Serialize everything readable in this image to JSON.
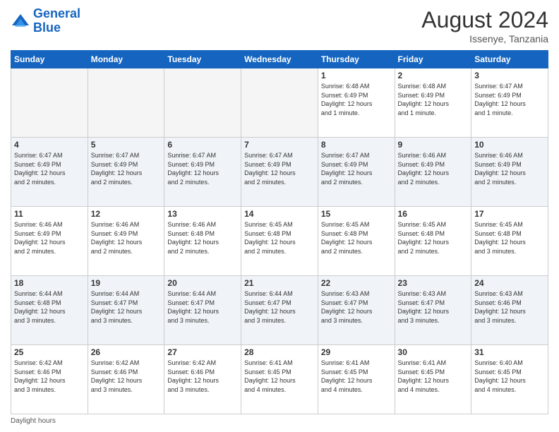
{
  "header": {
    "logo_line1": "General",
    "logo_line2": "Blue",
    "month_title": "August 2024",
    "location": "Issenye, Tanzania"
  },
  "footer": {
    "daylight_label": "Daylight hours"
  },
  "days_of_week": [
    "Sunday",
    "Monday",
    "Tuesday",
    "Wednesday",
    "Thursday",
    "Friday",
    "Saturday"
  ],
  "weeks": [
    [
      {
        "day": "",
        "info": ""
      },
      {
        "day": "",
        "info": ""
      },
      {
        "day": "",
        "info": ""
      },
      {
        "day": "",
        "info": ""
      },
      {
        "day": "1",
        "info": "Sunrise: 6:48 AM\nSunset: 6:49 PM\nDaylight: 12 hours\nand 1 minute."
      },
      {
        "day": "2",
        "info": "Sunrise: 6:48 AM\nSunset: 6:49 PM\nDaylight: 12 hours\nand 1 minute."
      },
      {
        "day": "3",
        "info": "Sunrise: 6:47 AM\nSunset: 6:49 PM\nDaylight: 12 hours\nand 1 minute."
      }
    ],
    [
      {
        "day": "4",
        "info": "Sunrise: 6:47 AM\nSunset: 6:49 PM\nDaylight: 12 hours\nand 2 minutes."
      },
      {
        "day": "5",
        "info": "Sunrise: 6:47 AM\nSunset: 6:49 PM\nDaylight: 12 hours\nand 2 minutes."
      },
      {
        "day": "6",
        "info": "Sunrise: 6:47 AM\nSunset: 6:49 PM\nDaylight: 12 hours\nand 2 minutes."
      },
      {
        "day": "7",
        "info": "Sunrise: 6:47 AM\nSunset: 6:49 PM\nDaylight: 12 hours\nand 2 minutes."
      },
      {
        "day": "8",
        "info": "Sunrise: 6:47 AM\nSunset: 6:49 PM\nDaylight: 12 hours\nand 2 minutes."
      },
      {
        "day": "9",
        "info": "Sunrise: 6:46 AM\nSunset: 6:49 PM\nDaylight: 12 hours\nand 2 minutes."
      },
      {
        "day": "10",
        "info": "Sunrise: 6:46 AM\nSunset: 6:49 PM\nDaylight: 12 hours\nand 2 minutes."
      }
    ],
    [
      {
        "day": "11",
        "info": "Sunrise: 6:46 AM\nSunset: 6:49 PM\nDaylight: 12 hours\nand 2 minutes."
      },
      {
        "day": "12",
        "info": "Sunrise: 6:46 AM\nSunset: 6:49 PM\nDaylight: 12 hours\nand 2 minutes."
      },
      {
        "day": "13",
        "info": "Sunrise: 6:46 AM\nSunset: 6:48 PM\nDaylight: 12 hours\nand 2 minutes."
      },
      {
        "day": "14",
        "info": "Sunrise: 6:45 AM\nSunset: 6:48 PM\nDaylight: 12 hours\nand 2 minutes."
      },
      {
        "day": "15",
        "info": "Sunrise: 6:45 AM\nSunset: 6:48 PM\nDaylight: 12 hours\nand 2 minutes."
      },
      {
        "day": "16",
        "info": "Sunrise: 6:45 AM\nSunset: 6:48 PM\nDaylight: 12 hours\nand 2 minutes."
      },
      {
        "day": "17",
        "info": "Sunrise: 6:45 AM\nSunset: 6:48 PM\nDaylight: 12 hours\nand 3 minutes."
      }
    ],
    [
      {
        "day": "18",
        "info": "Sunrise: 6:44 AM\nSunset: 6:48 PM\nDaylight: 12 hours\nand 3 minutes."
      },
      {
        "day": "19",
        "info": "Sunrise: 6:44 AM\nSunset: 6:47 PM\nDaylight: 12 hours\nand 3 minutes."
      },
      {
        "day": "20",
        "info": "Sunrise: 6:44 AM\nSunset: 6:47 PM\nDaylight: 12 hours\nand 3 minutes."
      },
      {
        "day": "21",
        "info": "Sunrise: 6:44 AM\nSunset: 6:47 PM\nDaylight: 12 hours\nand 3 minutes."
      },
      {
        "day": "22",
        "info": "Sunrise: 6:43 AM\nSunset: 6:47 PM\nDaylight: 12 hours\nand 3 minutes."
      },
      {
        "day": "23",
        "info": "Sunrise: 6:43 AM\nSunset: 6:47 PM\nDaylight: 12 hours\nand 3 minutes."
      },
      {
        "day": "24",
        "info": "Sunrise: 6:43 AM\nSunset: 6:46 PM\nDaylight: 12 hours\nand 3 minutes."
      }
    ],
    [
      {
        "day": "25",
        "info": "Sunrise: 6:42 AM\nSunset: 6:46 PM\nDaylight: 12 hours\nand 3 minutes."
      },
      {
        "day": "26",
        "info": "Sunrise: 6:42 AM\nSunset: 6:46 PM\nDaylight: 12 hours\nand 3 minutes."
      },
      {
        "day": "27",
        "info": "Sunrise: 6:42 AM\nSunset: 6:46 PM\nDaylight: 12 hours\nand 3 minutes."
      },
      {
        "day": "28",
        "info": "Sunrise: 6:41 AM\nSunset: 6:45 PM\nDaylight: 12 hours\nand 4 minutes."
      },
      {
        "day": "29",
        "info": "Sunrise: 6:41 AM\nSunset: 6:45 PM\nDaylight: 12 hours\nand 4 minutes."
      },
      {
        "day": "30",
        "info": "Sunrise: 6:41 AM\nSunset: 6:45 PM\nDaylight: 12 hours\nand 4 minutes."
      },
      {
        "day": "31",
        "info": "Sunrise: 6:40 AM\nSunset: 6:45 PM\nDaylight: 12 hours\nand 4 minutes."
      }
    ]
  ]
}
